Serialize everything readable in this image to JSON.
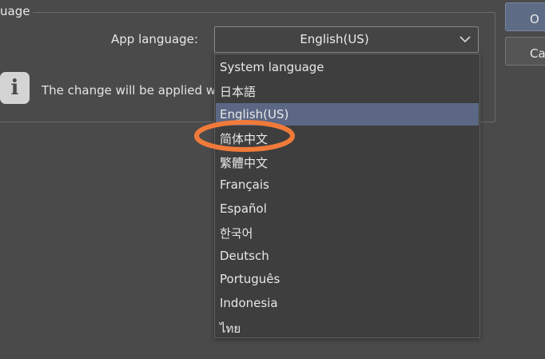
{
  "group": {
    "title": "uage"
  },
  "language": {
    "label": "App language:",
    "selected": "English(US)",
    "options": [
      "System language",
      "日本語",
      "English(US)",
      "简体中文",
      "繁體中文",
      "Français",
      "Español",
      "한국어",
      "Deutsch",
      "Português",
      "Indonesia",
      "ไทย"
    ],
    "selected_index": 2
  },
  "info": {
    "message": "The change will be applied whe",
    "icon": "info-icon"
  },
  "buttons": {
    "ok_label": "O",
    "cancel_label": "Ca"
  },
  "colors": {
    "background": "#4a4a4a",
    "dropdown_bg": "#3e3e3e",
    "selection": "#5b6784",
    "ok_button": "#5d6b85",
    "annotation": "#f07a3a"
  }
}
